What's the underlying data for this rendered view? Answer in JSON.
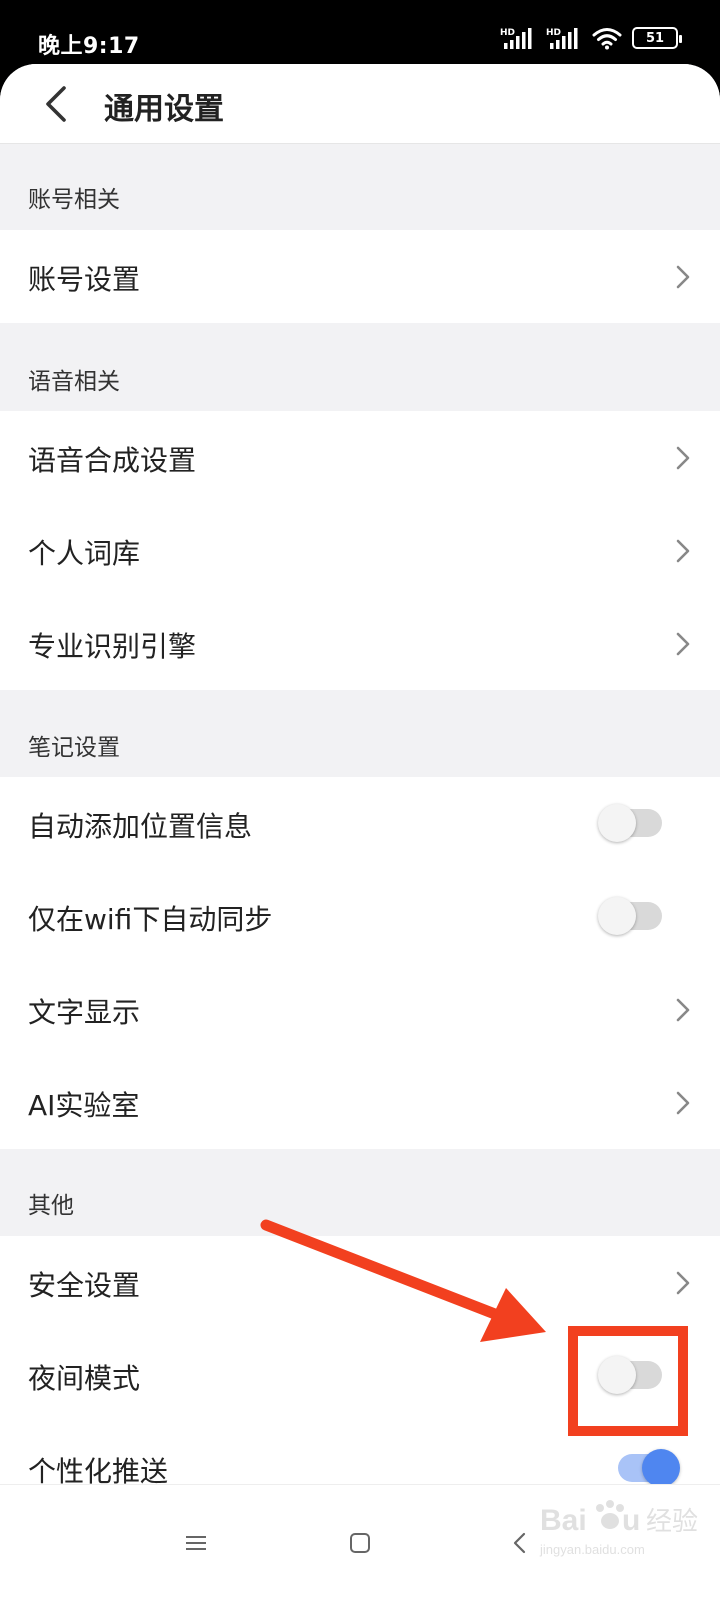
{
  "status_bar": {
    "time": "晚上9:17",
    "signal_1_label": "HD",
    "signal_2_label": "HD",
    "battery": "51"
  },
  "header": {
    "title": "通用设置"
  },
  "sections": [
    {
      "title": "账号相关",
      "items": [
        {
          "label": "账号设置",
          "type": "link"
        }
      ]
    },
    {
      "title": "语音相关",
      "items": [
        {
          "label": "语音合成设置",
          "type": "link"
        },
        {
          "label": "个人词库",
          "type": "link"
        },
        {
          "label": "专业识别引擎",
          "type": "link"
        }
      ]
    },
    {
      "title": "笔记设置",
      "items": [
        {
          "label": "自动添加位置信息",
          "type": "toggle",
          "on": false
        },
        {
          "label": "仅在wifi下自动同步",
          "type": "toggle",
          "on": false
        },
        {
          "label": "文字显示",
          "type": "link"
        },
        {
          "label": "AI实验室",
          "type": "link"
        }
      ]
    },
    {
      "title": "其他",
      "items": [
        {
          "label": "安全设置",
          "type": "link"
        },
        {
          "label": "夜间模式",
          "type": "toggle",
          "on": false
        },
        {
          "label": "个性化推送",
          "type": "toggle",
          "on": true
        }
      ]
    }
  ],
  "annotation": {
    "color": "#f2401f",
    "description_icons": [
      "arrow-icon",
      "highlight-box"
    ]
  },
  "watermark": {
    "brand": "Baidu经验",
    "domain": "jingyan.baidu.com"
  },
  "nav_bar": {
    "icons": [
      "menu-icon",
      "home-icon",
      "back-icon"
    ]
  }
}
